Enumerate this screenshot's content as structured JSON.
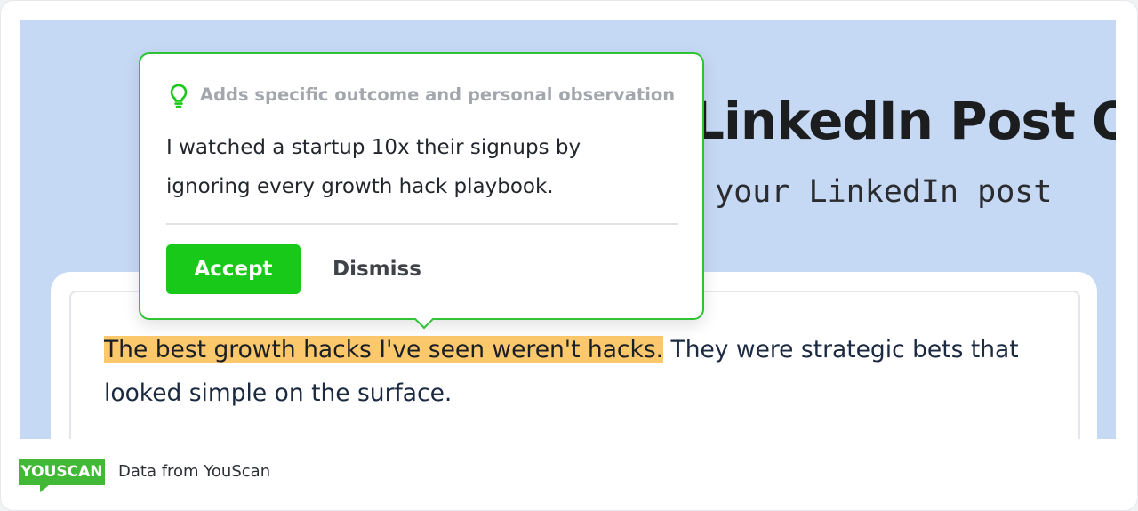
{
  "page": {
    "title": "LinkedIn Post Q",
    "subtitle": "l your LinkedIn post"
  },
  "suggestion_popover": {
    "reason": "Adds specific outcome and personal observation",
    "reason_icon": "lightbulb-icon",
    "suggested_text": "I watched a startup 10x their signups by ignoring every growth hack playbook.",
    "accept_label": "Accept",
    "dismiss_label": "Dismiss",
    "accent_color": "#19c919"
  },
  "editor": {
    "highlighted_text": "The best growth hacks I've seen weren't hacks.",
    "remaining_text": " They were strategic bets that looked simple on the surface.",
    "highlight_color": "#fbc86b"
  },
  "footer": {
    "logo_text": "YOUSCAN",
    "source_text": "Data from YouScan",
    "logo_color": "#42b936"
  }
}
